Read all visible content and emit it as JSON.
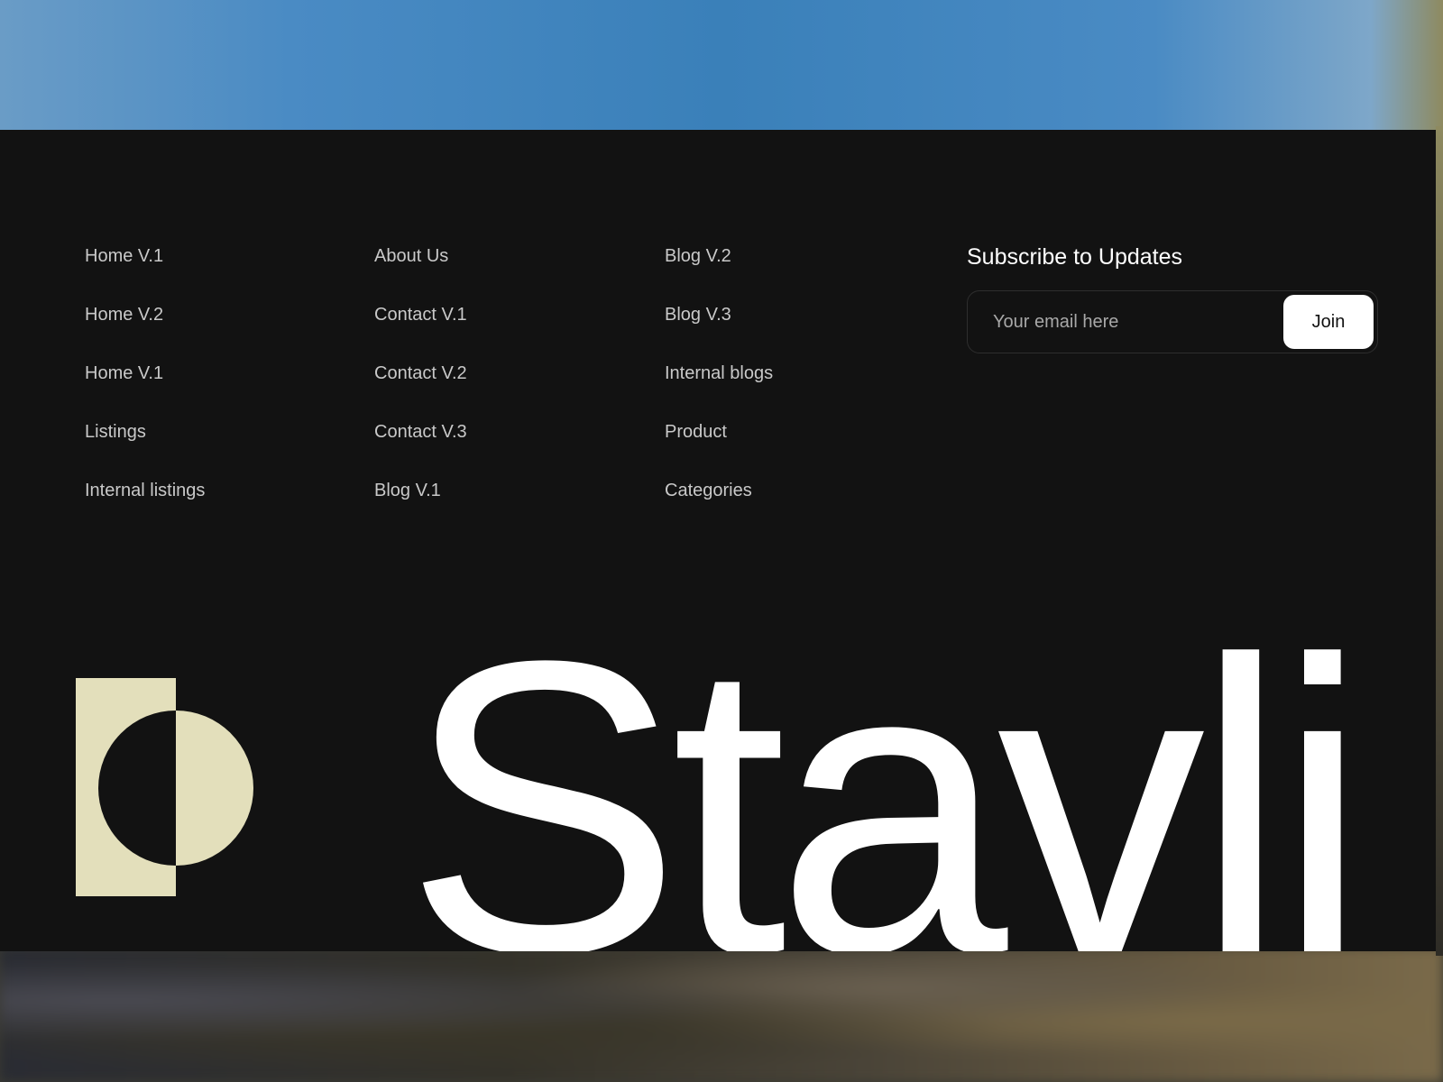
{
  "footer": {
    "nav_columns": [
      [
        "Home V.1",
        "Home V.2",
        "Home V.1",
        "Listings",
        "Internal listings"
      ],
      [
        "About Us",
        "Contact V.1",
        "Contact V.2",
        "Contact V.3",
        "Blog V.1"
      ],
      [
        "Blog V.2",
        "Blog V.3",
        "Internal blogs",
        "Product",
        "Categories"
      ]
    ],
    "subscribe": {
      "title": "Subscribe to Updates",
      "email_placeholder": "Your email here",
      "join_label": "Join"
    },
    "brand": {
      "wordmark": "Stavli",
      "logo_icon": "half-circle-rectangle-logo",
      "logo_color": "#e3dfbb"
    }
  },
  "colors": {
    "footer_bg": "#121212",
    "link_text": "#c9c9c9",
    "heading_text": "#ffffff"
  }
}
